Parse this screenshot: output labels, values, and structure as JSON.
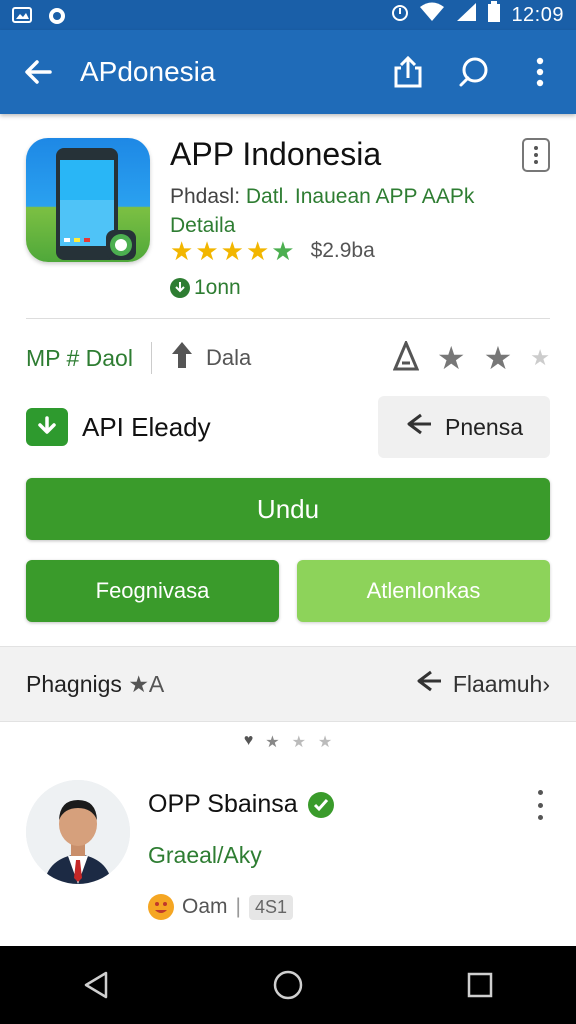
{
  "status_bar": {
    "time": "12:09",
    "icons": [
      "gallery-icon",
      "cloud-icon",
      "alarm-icon",
      "wifi-icon",
      "signal-icon",
      "battery-icon"
    ]
  },
  "app_bar": {
    "title": "APdonesia",
    "icons": [
      "back-arrow-icon",
      "share-icon",
      "search-icon",
      "more-vert-icon"
    ]
  },
  "header": {
    "app_name": "APP Indonesia",
    "developer": "Phdasl: ",
    "description": "Datl. Inauean APP AAPk Detaila",
    "rating_stars": 5,
    "price": "$2.9ba",
    "installs": "1onn"
  },
  "stats": {
    "left_label": "MP # Daol",
    "mid_label": "Dala"
  },
  "ready_row": {
    "label": "API Eleady",
    "share_label": "Pnensa"
  },
  "buttons": {
    "install": "Undu",
    "primary_left": "Feognivasa",
    "primary_right": "Atlenlonkas"
  },
  "section": {
    "title": "Phagnigs",
    "title_suffix": "★A",
    "action": "Flaamuh›"
  },
  "review": {
    "name": "OPP Sbainsa",
    "subtitle": "Graeal/Aky",
    "meta_label": "Oam",
    "meta_sep": "|",
    "count": "4S1"
  },
  "colors": {
    "app_bar": "#1f6bb8",
    "status_bar": "#1a5fa8",
    "primary_green": "#3a9b2b",
    "light_green": "#8dd35a",
    "text_green": "#2e7d32",
    "star_yellow": "#f2b600"
  }
}
